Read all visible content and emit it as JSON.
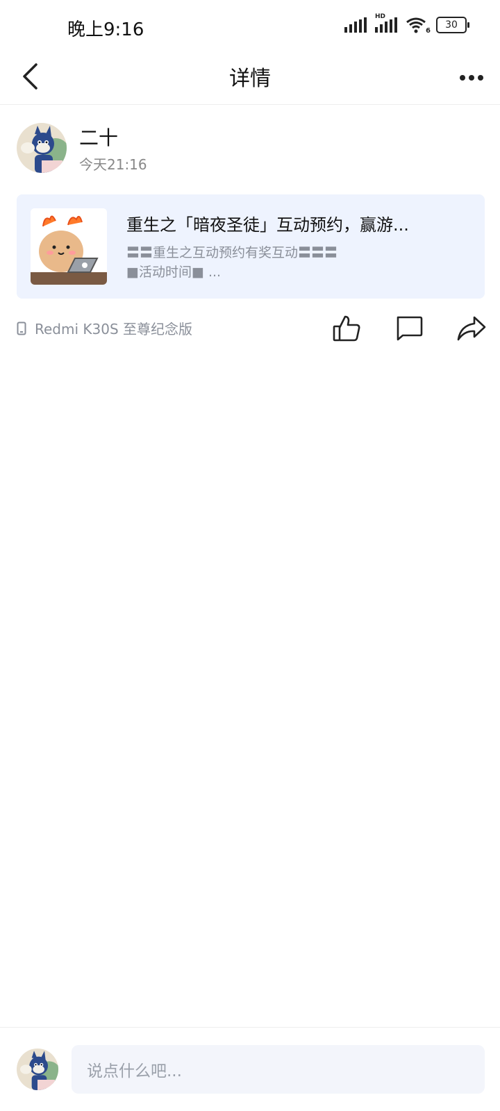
{
  "status": {
    "time": "晚上9:16",
    "battery": "30",
    "network_badge": "HD",
    "wifi_badge": "6"
  },
  "header": {
    "title": "详情"
  },
  "post": {
    "author_name": "二十",
    "time": "今天21:16",
    "card": {
      "title": "重生之「暗夜圣徒」互动预约，赢游...",
      "desc_line1": "〓〓重生之互动预约有奖互动〓〓〓",
      "desc_line2": "■活动时间■ ..."
    },
    "device": "Redmi K30S 至尊纪念版"
  },
  "comment_box": {
    "placeholder": "说点什么吧..."
  },
  "colors": {
    "card_bg": "#eef3fe",
    "muted_text": "#8a8f99"
  }
}
